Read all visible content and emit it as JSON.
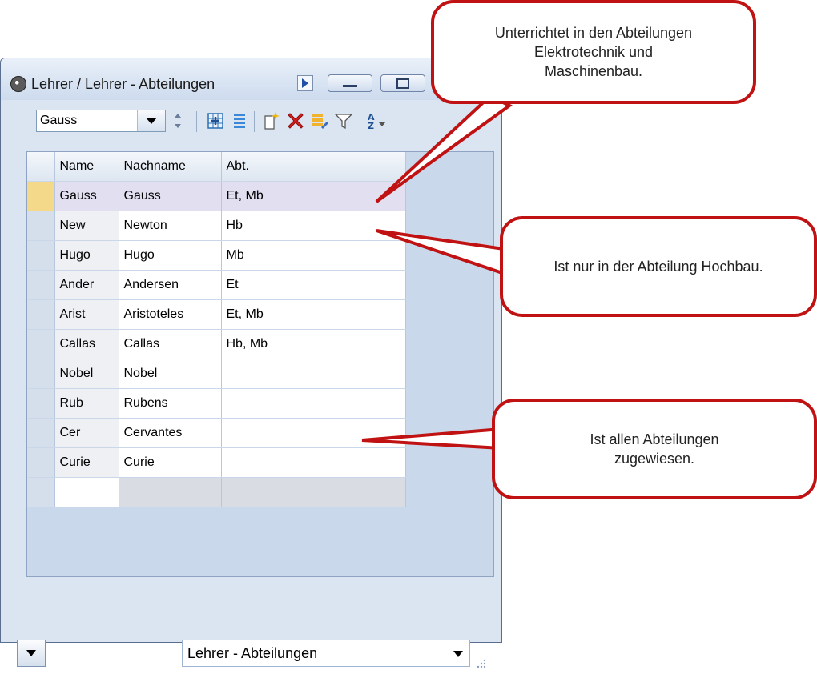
{
  "window": {
    "title": "Lehrer / Lehrer - Abteilungen",
    "controls": [
      "minimize",
      "maximize"
    ]
  },
  "toolbar": {
    "combo_value": "Gauss",
    "icons": [
      "add-row-icon",
      "columns-icon",
      "new-record-icon",
      "delete-icon",
      "edit-list-icon",
      "filter-icon",
      "sort-icon"
    ]
  },
  "grid": {
    "columns": [
      "Name",
      "Nachname",
      "Abt."
    ],
    "rows": [
      {
        "name": "Gauss",
        "nachname": "Gauss",
        "abt": "Et, Mb"
      },
      {
        "name": "New",
        "nachname": "Newton",
        "abt": "Hb"
      },
      {
        "name": "Hugo",
        "nachname": "Hugo",
        "abt": "Mb"
      },
      {
        "name": "Ander",
        "nachname": "Andersen",
        "abt": "Et"
      },
      {
        "name": "Arist",
        "nachname": "Aristoteles",
        "abt": "Et, Mb"
      },
      {
        "name": "Callas",
        "nachname": "Callas",
        "abt": "Hb, Mb"
      },
      {
        "name": "Nobel",
        "nachname": "Nobel",
        "abt": ""
      },
      {
        "name": "Rub",
        "nachname": "Rubens",
        "abt": ""
      },
      {
        "name": "Cer",
        "nachname": "Cervantes",
        "abt": ""
      },
      {
        "name": "Curie",
        "nachname": "Curie",
        "abt": ""
      }
    ],
    "active_row": 0
  },
  "bottom": {
    "view_select": "Lehrer - Abteilungen"
  },
  "callouts": {
    "top": "Unterrichtet in den Abteilungen Elektrotechnik und Maschinenbau.",
    "middle": "Ist nur in der Abteilung Hochbau.",
    "bottom": "Ist allen Abteilungen zugewiesen."
  },
  "colors": {
    "callout_border": "#c01212",
    "window_bg": "#dbe5f2",
    "active_row": "#e1dff0",
    "active_marker": "#f5d98b"
  }
}
